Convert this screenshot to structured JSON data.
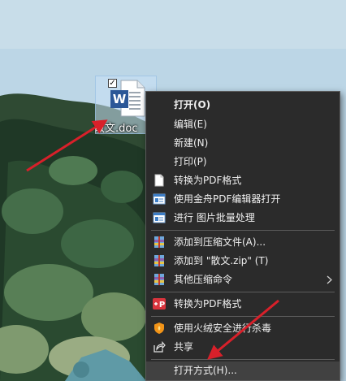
{
  "file": {
    "name": "散文.doc",
    "icon_letter": "W",
    "selected": true
  },
  "context_menu": {
    "items": [
      {
        "label": "打开(O)",
        "bold": true,
        "icon": null
      },
      {
        "label": "编辑(E)",
        "icon": null
      },
      {
        "label": "新建(N)",
        "icon": null
      },
      {
        "label": "打印(P)",
        "icon": null
      },
      {
        "label": "转换为PDF格式",
        "icon": "document-icon"
      },
      {
        "label": "使用金舟PDF编辑器打开",
        "icon": "pdf-editor-icon"
      },
      {
        "label": "进行 图片批量处理",
        "icon": "image-batch-icon"
      },
      {
        "label": "添加到压缩文件(A)...",
        "icon": "winrar-icon"
      },
      {
        "label": "添加到 \"散文.zip\" (T)",
        "icon": "winrar-icon"
      },
      {
        "label": "其他压缩命令",
        "icon": "winrar-icon",
        "submenu": true
      },
      {
        "label": "转换为PDF格式",
        "icon": "pdf-convert-icon",
        "badge": "P"
      },
      {
        "label": "使用火绒安全进行杀毒",
        "icon": "huorong-shield-icon"
      },
      {
        "label": "共享",
        "icon": "share-icon"
      },
      {
        "label": "打开方式(H)...",
        "icon": null,
        "highlighted": true
      }
    ]
  },
  "colors": {
    "menu_bg": "#2b2b2b",
    "menu_text": "#f0f0f0",
    "highlight": "#414141",
    "separator": "#5c5c5c",
    "word_blue": "#2b5797",
    "pdf_red": "#d9343d",
    "shield_orange": "#f29418",
    "arrow_red": "#d8202a"
  }
}
